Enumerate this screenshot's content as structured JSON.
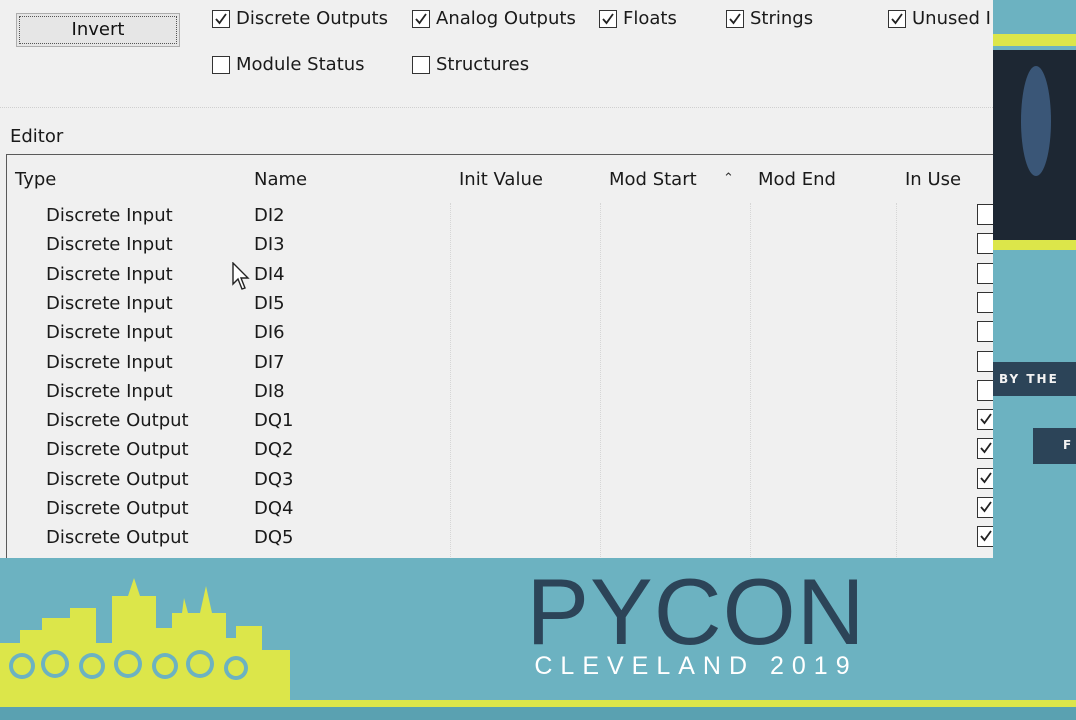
{
  "toolbar": {
    "invert_label": "Invert"
  },
  "filters": [
    {
      "label": "Discrete Outputs",
      "checked": true
    },
    {
      "label": "Analog Outputs",
      "checked": true
    },
    {
      "label": "Floats",
      "checked": true
    },
    {
      "label": "Strings",
      "checked": true
    },
    {
      "label": "Unused I",
      "checked": true
    },
    {
      "label": "Module Status",
      "checked": false
    },
    {
      "label": "Structures",
      "checked": false
    }
  ],
  "editor": {
    "title": "Editor",
    "columns": [
      "Type",
      "Name",
      "Init Value",
      "Mod Start",
      "Mod End",
      "In Use"
    ],
    "sort_icon": "chevron-up-icon",
    "rows": [
      {
        "type": "Discrete Input",
        "name": "DI2",
        "in_use": false
      },
      {
        "type": "Discrete Input",
        "name": "DI3",
        "in_use": false
      },
      {
        "type": "Discrete Input",
        "name": "DI4",
        "in_use": false
      },
      {
        "type": "Discrete Input",
        "name": "DI5",
        "in_use": false
      },
      {
        "type": "Discrete Input",
        "name": "DI6",
        "in_use": false
      },
      {
        "type": "Discrete Input",
        "name": "DI7",
        "in_use": false
      },
      {
        "type": "Discrete Input",
        "name": "DI8",
        "in_use": false
      },
      {
        "type": "Discrete Output",
        "name": "DQ1",
        "in_use": true
      },
      {
        "type": "Discrete Output",
        "name": "DQ2",
        "in_use": true
      },
      {
        "type": "Discrete Output",
        "name": "DQ3",
        "in_use": true
      },
      {
        "type": "Discrete Output",
        "name": "DQ4",
        "in_use": true
      },
      {
        "type": "Discrete Output",
        "name": "DQ5",
        "in_use": true
      }
    ]
  },
  "banner": {
    "title": "PYCON",
    "subtitle": "CLEVELAND 2019",
    "side_text": "BY THE",
    "side_flag_text": "F",
    "colors": {
      "teal": "#6cb2c1",
      "navy": "#2c4458",
      "yellow": "#dce64a"
    }
  }
}
